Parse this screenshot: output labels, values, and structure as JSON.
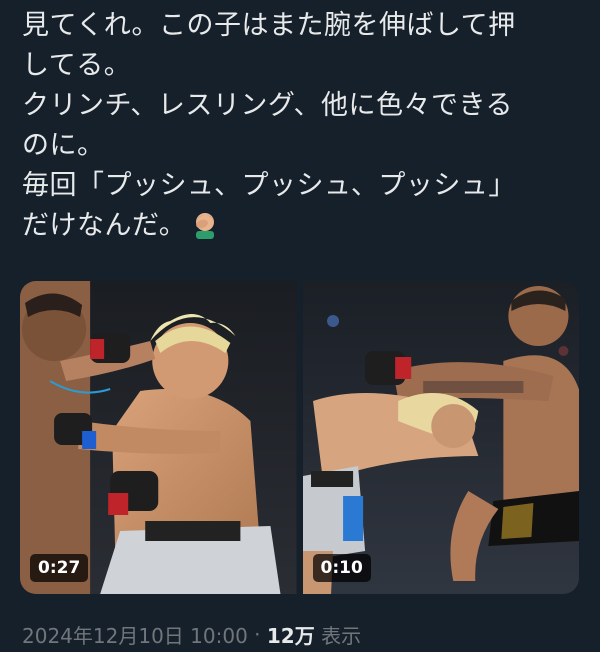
{
  "tweet": {
    "lines": [
      "見てくれ。この子はまた腕を伸ばして押",
      "してる。",
      "クリンチ、レスリング、他に色々できる",
      "のに。",
      "毎回「プッシュ、プッシュ、プッシュ」",
      "だけなんだ。"
    ],
    "emoji": "face-palm-emoji"
  },
  "media": [
    {
      "duration": "0:27"
    },
    {
      "duration": "0:10"
    }
  ],
  "meta": {
    "timestamp": "2024年12月10日 10:00",
    "separator": "·",
    "views_count": "12万",
    "views_label": "表示"
  },
  "colors": {
    "background": "#15202b",
    "text": "#e7e9ea",
    "muted": "#71767b"
  }
}
